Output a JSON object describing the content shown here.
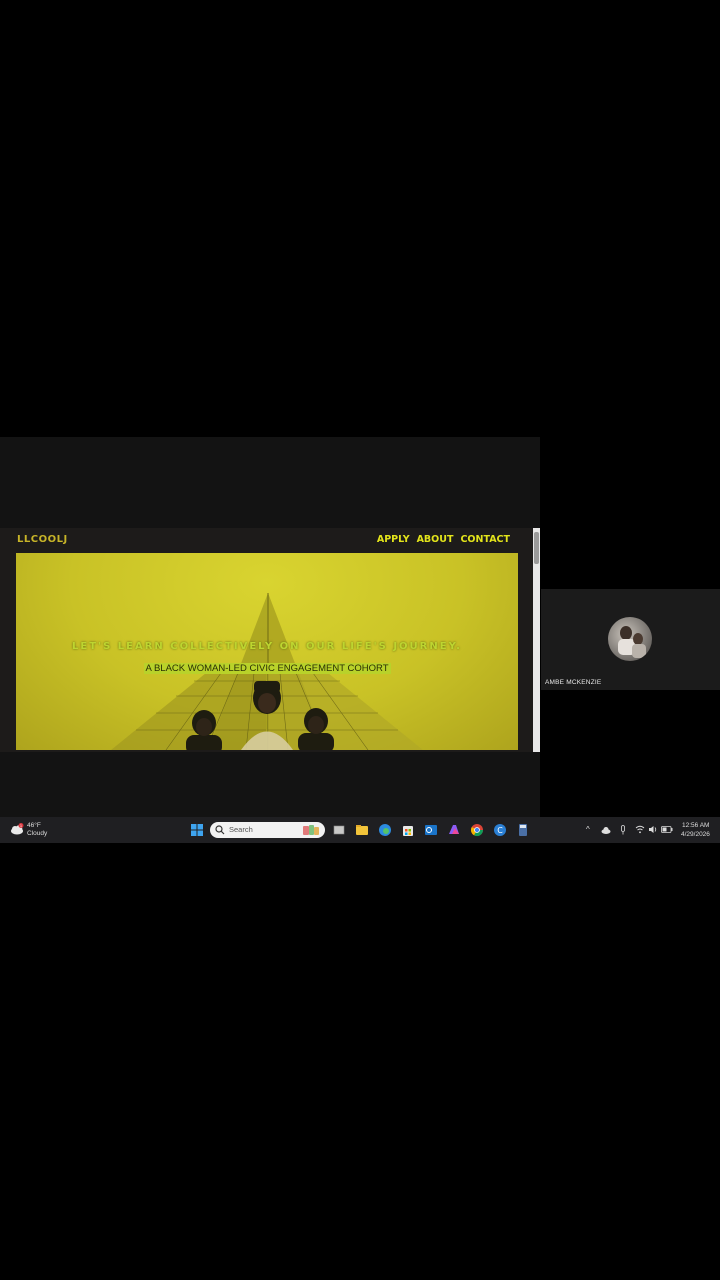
{
  "site": {
    "logo": "LLCOOLJ",
    "nav": [
      "APPLY",
      "ABOUT",
      "CONTACT"
    ],
    "hero_title": "LET'S LEARN COLLECTIVELY ON OUR LIFE'S JOURNEY.",
    "hero_subtitle": "A BLACK WOMAN-LED CIVIC ENGAGEMENT COHORT"
  },
  "participant": {
    "name": "AMBE MCKENZIE"
  },
  "taskbar": {
    "weather_temp": "46°F",
    "weather_desc": "Cloudy",
    "weather_badge": "1",
    "search_placeholder": "Search",
    "time": "12:56 AM",
    "date": "4/29/2026",
    "pinned_icons": [
      "windows-start-icon",
      "task-view-icon",
      "file-explorer-icon",
      "edge-icon",
      "store-icon",
      "outlook-icon",
      "copilot-icon",
      "chrome-icon",
      "browser-icon",
      "calculator-icon"
    ],
    "tray_icons": [
      "chevron-up-icon",
      "cloud-icon",
      "microphone-icon",
      "wifi-icon",
      "volume-icon",
      "battery-icon"
    ]
  },
  "colors": {
    "hero_yellow": "#c9c226",
    "nav_yellow": "#e3e41b",
    "taskbar_bg": "#1f1f22"
  }
}
